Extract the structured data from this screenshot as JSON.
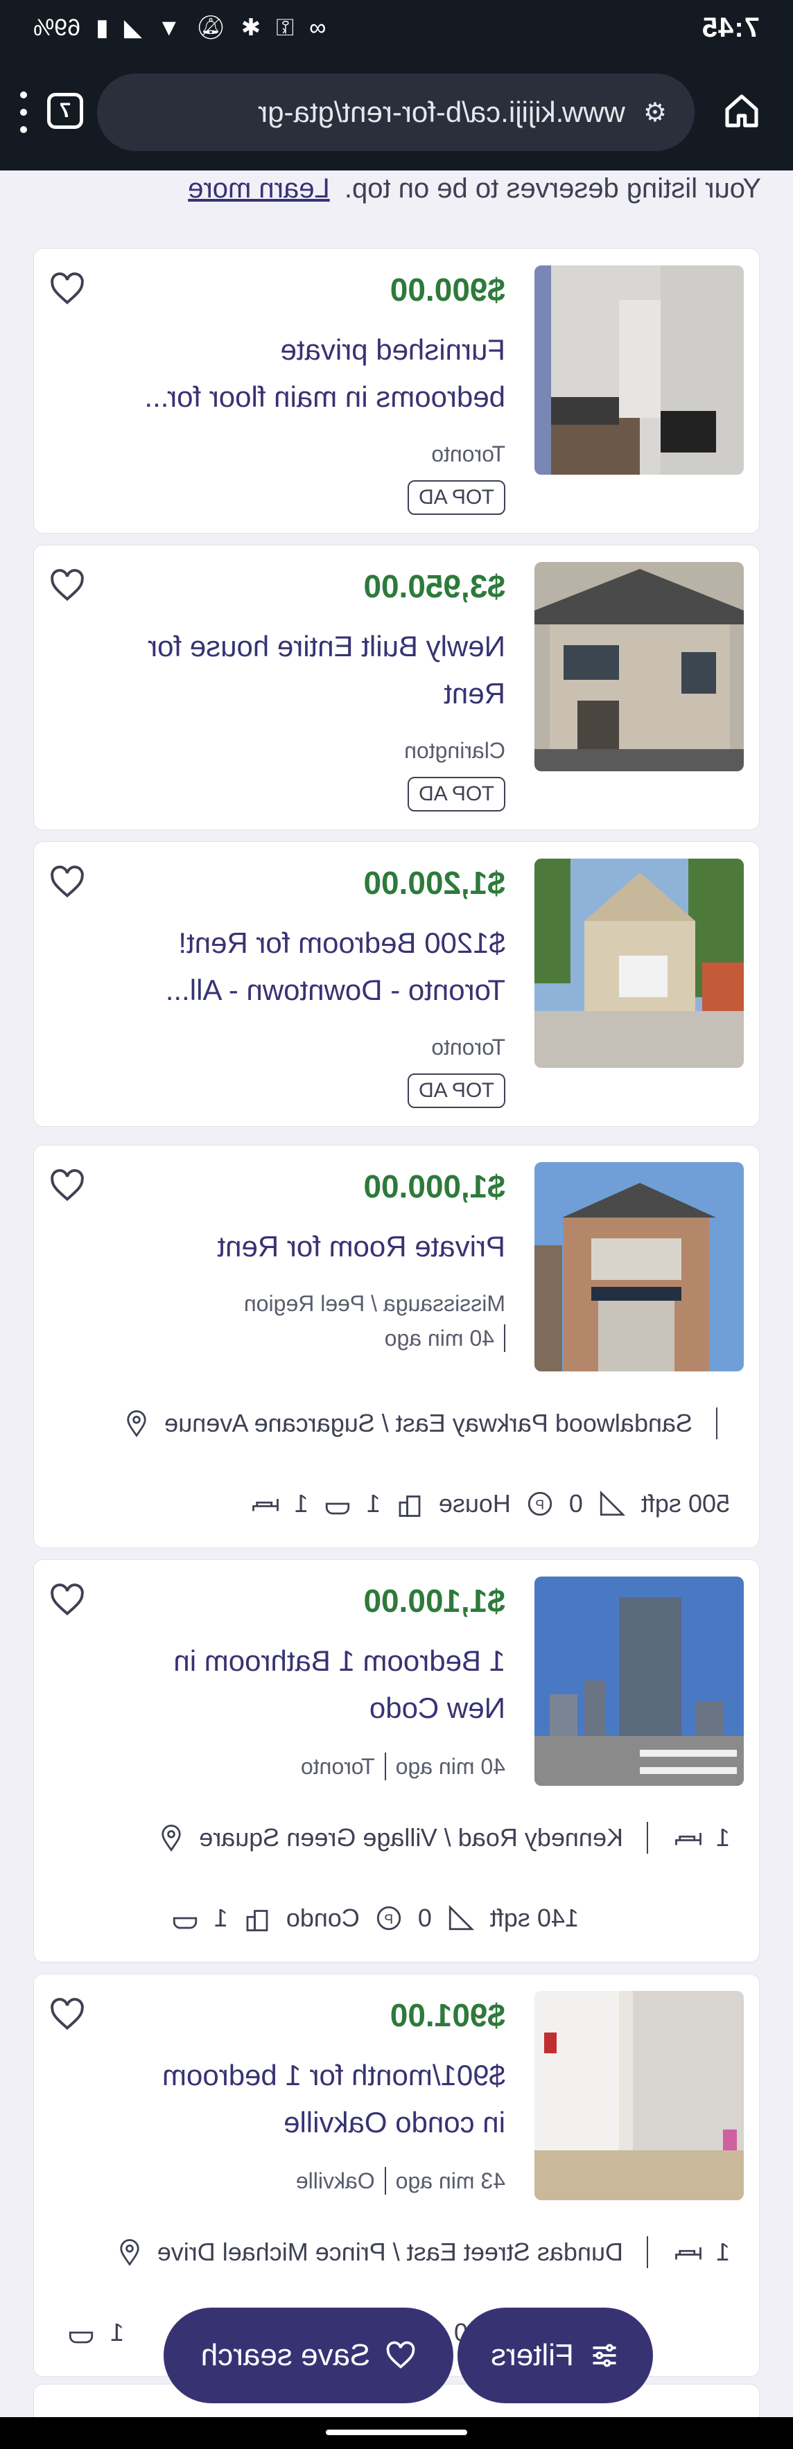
{
  "status_bar": {
    "time": "7:45",
    "battery": "69%"
  },
  "browser": {
    "url": "www.kijiji.ca/b-for-rent/gta-gr",
    "tab_count": "7"
  },
  "promo": {
    "text": "Your listing deserves to be on top.",
    "link": "Learn more"
  },
  "listings": [
    {
      "price": "$900.00",
      "title_line1": "Furnished private",
      "title_line2": "bedrooms in main floor for...",
      "location": "Toronto",
      "badge": "TOP AD"
    },
    {
      "price": "$3,950.00",
      "title_line1": "Newly Built Entire house for",
      "title_line2": "Rent",
      "location": "Clarington",
      "badge": "TOP AD"
    },
    {
      "price": "$1,200.00",
      "title_line1": "$1200 Bedroom for Rent!",
      "title_line2": "Toronto - Downtown - All...",
      "location": "Toronto",
      "badge": "TOP AD"
    },
    {
      "price": "$1,000.00",
      "title_line1": "Private Room for Rent",
      "location": "Mississauga / Peel Region",
      "time": "40 min ago",
      "address": "Sandalwood Parkway East / Sugarcane Avenue",
      "beds": "",
      "baths": "1",
      "type": "House",
      "parking": "0",
      "size": "500 sqft",
      "bed_count": "1"
    },
    {
      "price": "$1,100.00",
      "title_line1": "1 Bedroom 1 Bathroom in",
      "title_line2": "New Codo",
      "location": "Toronto",
      "time": "40 min ago",
      "address": "Kennedy Road / Village Green Square",
      "bed_count": "1",
      "baths": "1",
      "type": "Condo",
      "parking": "0",
      "size": "140 sqft"
    },
    {
      "price": "$901.00",
      "title_line1": "$901/month for 1 bedroom",
      "title_line2": "in condo Oakville",
      "location": "Oakville",
      "time": "43 min ago",
      "address": "Dundas Street East / Prince Michael Drive",
      "bed_count": "1",
      "baths": "1",
      "parking": "0"
    }
  ],
  "actions": {
    "filters": "Filters",
    "save_search": "Save search"
  },
  "colors": {
    "brand": "#373373",
    "price": "#2d7a3a",
    "bar": "#141a21"
  }
}
